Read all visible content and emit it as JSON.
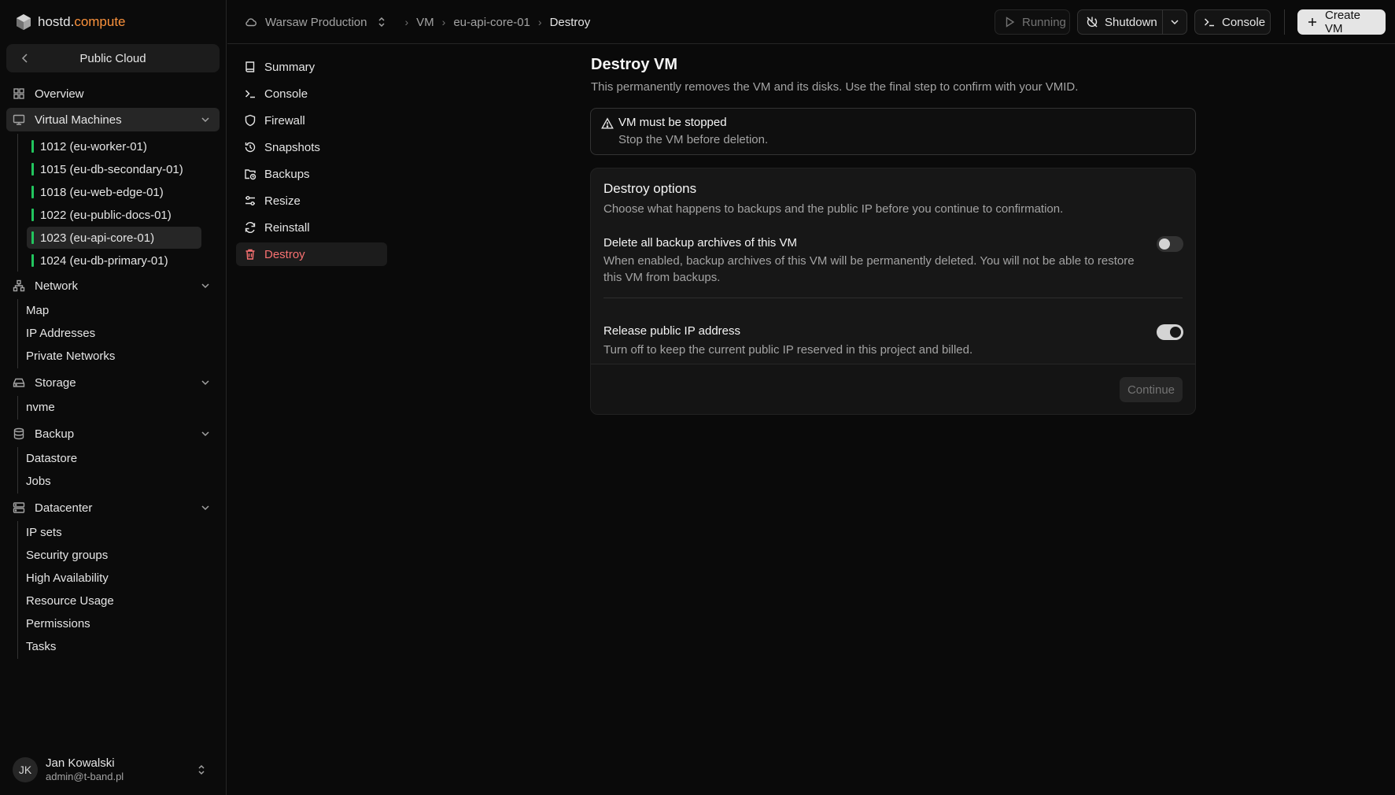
{
  "brand": {
    "name_prefix": "hostd.",
    "name_accent": "compute",
    "accent_color": "#fb923c"
  },
  "sidebar": {
    "switcher_label": "Public Cloud",
    "overview": "Overview",
    "vms_section": "Virtual Machines",
    "vms": [
      {
        "label": "1012 (eu-worker-01)",
        "status_color": "#22c55e"
      },
      {
        "label": "1015 (eu-db-secondary-01)",
        "status_color": "#22c55e"
      },
      {
        "label": "1018 (eu-web-edge-01)",
        "status_color": "#22c55e"
      },
      {
        "label": "1022 (eu-public-docs-01)",
        "status_color": "#22c55e"
      },
      {
        "label": "1023 (eu-api-core-01)",
        "status_color": "#22c55e",
        "selected": true
      },
      {
        "label": "1024 (eu-db-primary-01)",
        "status_color": "#22c55e"
      }
    ],
    "network": {
      "label": "Network",
      "items": [
        "Map",
        "IP Addresses",
        "Private Networks"
      ]
    },
    "storage": {
      "label": "Storage",
      "items": [
        "nvme"
      ]
    },
    "backup": {
      "label": "Backup",
      "items": [
        "Datastore",
        "Jobs"
      ]
    },
    "datacenter": {
      "label": "Datacenter",
      "items": [
        "IP sets",
        "Security groups",
        "High Availability",
        "Resource Usage",
        "Permissions",
        "Tasks"
      ]
    }
  },
  "user": {
    "initials": "JK",
    "name": "Jan Kowalski",
    "email": "admin@t-band.pl"
  },
  "topbar": {
    "project": "Warsaw Production",
    "breadcrumbs": [
      "VM",
      "eu-api-core-01",
      "Destroy"
    ],
    "status_label": "Running",
    "shutdown_label": "Shutdown",
    "console_label": "Console",
    "create_label": "Create VM"
  },
  "subnav": [
    "Summary",
    "Console",
    "Firewall",
    "Snapshots",
    "Backups",
    "Resize",
    "Reinstall",
    "Destroy"
  ],
  "main": {
    "title": "Destroy VM",
    "description": "This permanently removes the VM and its disks. Use the final step to confirm with your VMID.",
    "alert": {
      "title": "VM must be stopped",
      "text": "Stop the VM before deletion."
    },
    "card": {
      "title": "Destroy options",
      "description": "Choose what happens to backups and the public IP before you continue to confirmation.",
      "options": [
        {
          "title": "Delete all backup archives of this VM",
          "description": "When enabled, backup archives of this VM will be permanently deleted. You will not be able to restore this VM from backups.",
          "enabled": false
        },
        {
          "title": "Release public IP address",
          "description": "Turn off to keep the current public IP reserved in this project and billed.",
          "enabled": true
        }
      ],
      "continue_label": "Continue"
    }
  },
  "colors": {
    "danger": "#f87171",
    "status_ok": "#22c55e"
  }
}
